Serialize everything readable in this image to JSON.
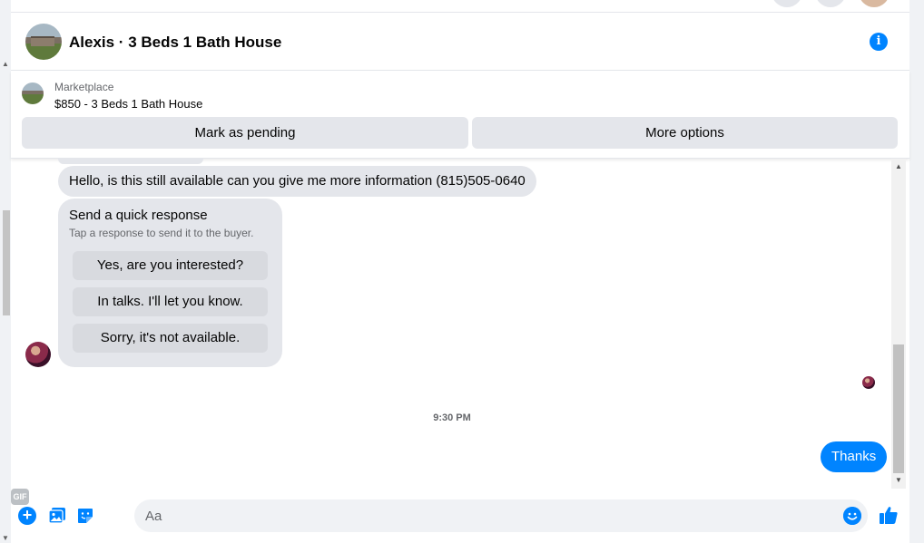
{
  "header": {
    "title": "Alexis · 3 Beds 1 Bath House"
  },
  "listing": {
    "source": "Marketplace",
    "price_title": "$850 - 3 Beds 1 Bath House",
    "mark_pending_label": "Mark as pending",
    "more_options_label": "More options"
  },
  "messages": {
    "incoming_text": "Hello, is this still available can you give me more information (815)505-0640",
    "quick_response": {
      "title": "Send a quick response",
      "subtitle": "Tap a response to send it to the buyer.",
      "options": [
        "Yes, are you interested?",
        "In talks. I'll let you know.",
        "Sorry, it's not available."
      ]
    },
    "timestamp": "9:30 PM",
    "outgoing_text": "Thanks"
  },
  "composer": {
    "placeholder": "Aa",
    "gif_label": "GIF"
  },
  "colors": {
    "accent": "#0084ff",
    "bubble_gray": "#e4e6eb"
  },
  "icons": [
    "info-icon",
    "plus-icon",
    "image-icon",
    "sticker-icon",
    "gif-icon",
    "emoji-icon",
    "like-icon"
  ]
}
